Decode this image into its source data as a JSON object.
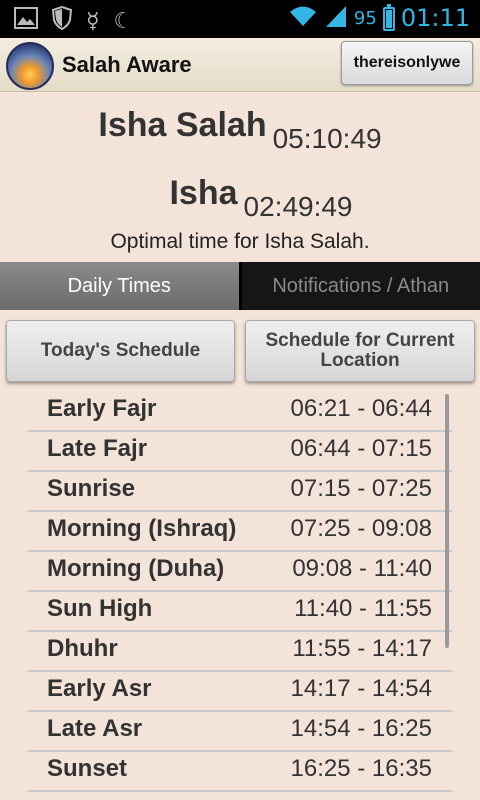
{
  "status_bar": {
    "icons": [
      "image-icon",
      "shield-icon",
      "mercury-symbol-icon",
      "crescent-moon-icon"
    ],
    "battery_percent": "95",
    "time": "01:11",
    "accent_color": "#33b5e5"
  },
  "app": {
    "title": "Salah Aware",
    "account_button": "thereisonlywe"
  },
  "current": {
    "salah_title": "Isha Salah",
    "salah_timer": "05:10:49",
    "prayer_title": "Isha",
    "prayer_timer": "02:49:49",
    "message": "Optimal time for Isha Salah."
  },
  "tabs": [
    {
      "label": "Daily Times",
      "active": true
    },
    {
      "label": "Notifications / Athan",
      "active": false
    }
  ],
  "buttons": {
    "today": "Today's Schedule",
    "location": "Schedule for Current Location"
  },
  "schedule": [
    {
      "name": "Early Fajr",
      "time": "06:21 - 06:44"
    },
    {
      "name": "Late Fajr",
      "time": "06:44 - 07:15"
    },
    {
      "name": "Sunrise",
      "time": "07:15 - 07:25"
    },
    {
      "name": "Morning (Ishraq)",
      "time": "07:25 - 09:08"
    },
    {
      "name": "Morning (Duha)",
      "time": "09:08 - 11:40"
    },
    {
      "name": "Sun High",
      "time": "11:40 - 11:55"
    },
    {
      "name": "Dhuhr",
      "time": "11:55 - 14:17"
    },
    {
      "name": "Early Asr",
      "time": "14:17 - 14:54"
    },
    {
      "name": "Late Asr",
      "time": "14:54 - 16:25"
    },
    {
      "name": "Sunset",
      "time": "16:25 - 16:35"
    }
  ]
}
